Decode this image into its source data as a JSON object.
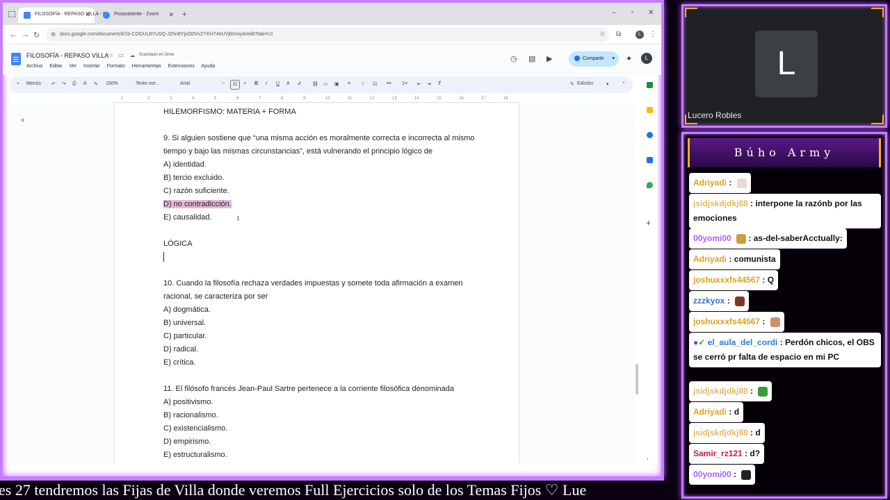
{
  "browser": {
    "tabs": [
      {
        "label": "FILOSOFÍA - REPASO VILLA - D",
        "active": true
      },
      {
        "label": "Posasistente - Zoom",
        "active": false
      }
    ],
    "url": "docs.google.com/document/d/1b-COGUL8YUSQ-JZhn8YjsODVvZYKH74eUVjt0nniyA/edit?tab=t.0"
  },
  "docs": {
    "title": "FILOSOFÍA - REPASO VILLA",
    "saved_status": "Guardado en Drive",
    "menus": [
      "Archivo",
      "Editar",
      "Ver",
      "Insertar",
      "Formato",
      "Herramientas",
      "Extensiones",
      "Ayuda"
    ],
    "share_label": "Compartir",
    "user_initial": "L",
    "toolbar": {
      "menus_label": "Menús",
      "zoom": "150%",
      "style": "Texto nor...",
      "font": "Arial",
      "font_size": "11",
      "mode": "Edición"
    },
    "ruler_marks": [
      "1",
      "2",
      "3",
      "4",
      "5",
      "6",
      "7",
      "8",
      "9",
      "10",
      "11",
      "12",
      "13",
      "14",
      "15",
      "16",
      "17",
      "18"
    ],
    "lines": [
      {
        "text": "HILEMORFISMO: MATERIA + FORMA"
      },
      {
        "text": ""
      },
      {
        "text": "9. Si alguien sostiene que “una misma acción es moralmente correcta e incorrecta al mismo"
      },
      {
        "text": "tiempo y bajo las mismas circunstancias”, está vulnerando el principio lógico de"
      },
      {
        "text": "A) identidad."
      },
      {
        "text": "B) tercio excluido."
      },
      {
        "text": "C) razón suficiente."
      },
      {
        "text": "D) no contradicción.",
        "highlight": true
      },
      {
        "text": "E) causalidad."
      },
      {
        "text": ""
      },
      {
        "text": "LÓGICA"
      },
      {
        "text": "",
        "cursor": true
      },
      {
        "text": ""
      },
      {
        "text": "10. Cuando la filosofía rechaza verdades impuestas y somete toda afirmación a examen"
      },
      {
        "text": "racional, se caracteriza por ser"
      },
      {
        "text": "A) dogmática."
      },
      {
        "text": "B) universal."
      },
      {
        "text": "C) particular."
      },
      {
        "text": "D) radical."
      },
      {
        "text": "E) crítica."
      },
      {
        "text": ""
      },
      {
        "text": "11. El filósofo francés Jean-Paul Sartre pertenece a la corriente filosófica denominada"
      },
      {
        "text": "A) positivismo."
      },
      {
        "text": "B) racionalismo."
      },
      {
        "text": "C) existencialismo."
      },
      {
        "text": "D) empirismo."
      },
      {
        "text": "E) estructuralismo."
      }
    ]
  },
  "webcam": {
    "initial": "L",
    "name": "Lucero Robles"
  },
  "chat": {
    "title": "Búho Army",
    "messages": [
      {
        "user": "Adriyadi",
        "color": "#e0a020",
        "text": ":",
        "emote": "#caa"
      },
      {
        "user": "jsidjskdjdkj88",
        "color": "#e6b85c",
        "text": ": interpone la razónb por las emociones"
      },
      {
        "user": "00yomi00",
        "color": "#b05cff",
        "text": ":  as-del-saberAcctually:",
        "emote_before": "#c8a040"
      },
      {
        "user": "Adriyadi",
        "color": "#e0a020",
        "text": ": comunista"
      },
      {
        "user": "joshuxxxfs44567",
        "color": "#e0a020",
        "text": ": Q"
      },
      {
        "user": "zzzkyox",
        "color": "#3a6fd8",
        "text": ":",
        "emote": "#7a3a2a"
      },
      {
        "user": "joshuxxxfs44567",
        "color": "#e0a020",
        "text": ":",
        "emote": "#d09070"
      },
      {
        "user": "el_aula_del_cordi",
        "color": "#2a7ad8",
        "text": ": Perdón chicos, el OBS se cerró pr falta de espacio en mi PC"
      },
      {
        "user": "jsidjskdjdkj88",
        "color": "#e6b85c",
        "text": ":",
        "emote": "#3a9a3a"
      },
      {
        "user": "Adriyadi",
        "color": "#e0a020",
        "text": ": d"
      },
      {
        "user": "jsidjskdjdkj88",
        "color": "#e6b85c",
        "text": ": d"
      },
      {
        "user": "Samir_rz121",
        "color": "#c02040",
        "text": ": d?"
      },
      {
        "user": "00yomi00",
        "color": "#b05cff",
        "text": ":",
        "emote": "#222"
      }
    ]
  },
  "ticker": {
    "text": "es 27 tendremos las Fijas de Villa donde veremos Full Ejercicios solo de los Temas Fijos    ♡   Lue"
  }
}
